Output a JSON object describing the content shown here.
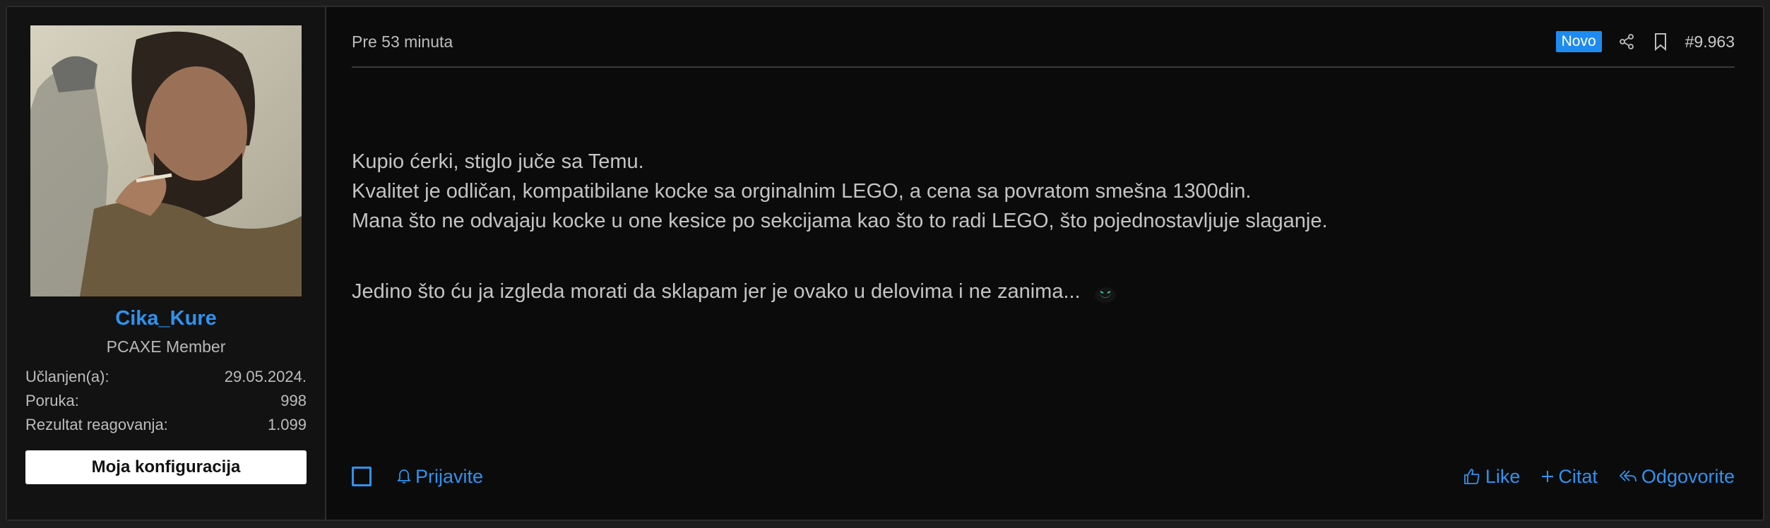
{
  "user": {
    "username": "Cika_Kure",
    "title": "PCAXE Member",
    "stats": [
      {
        "label": "Učlanjen(a):",
        "value": "29.05.2024."
      },
      {
        "label": "Poruka:",
        "value": "998"
      },
      {
        "label": "Rezultat reagovanja:",
        "value": "1.099"
      }
    ],
    "config_button": "Moja konfiguracija"
  },
  "post": {
    "time": "Pre 53 minuta",
    "badge": "Novo",
    "number": "#9.963",
    "lines": [
      "Kupio ćerki, stiglo juče sa Temu.",
      "Kvalitet je odličan, kompatibilane kocke sa orginalnim LEGO, a cena sa povratom smešna 1300din.",
      "Mana što ne odvajaju kocke u one kesice po sekcijama kao što to radi LEGO, što pojednostavljuje slaganje.",
      "Jedino što ću ja izgleda morati da sklapam jer je ovako u delovima i ne zanima..."
    ],
    "icons": [
      "share-icon",
      "bookmark-icon",
      "bell-icon",
      "thumbs-up-icon",
      "plus-icon",
      "reply-icon",
      "smile-emoji-icon"
    ]
  },
  "footer": {
    "report": "Prijavite",
    "like": "Like",
    "quote": "Citat",
    "reply": "Odgovorite"
  },
  "colors": {
    "accent": "#2f93ee",
    "badge": "#1e8bf0",
    "background": "#0b0b0b"
  }
}
